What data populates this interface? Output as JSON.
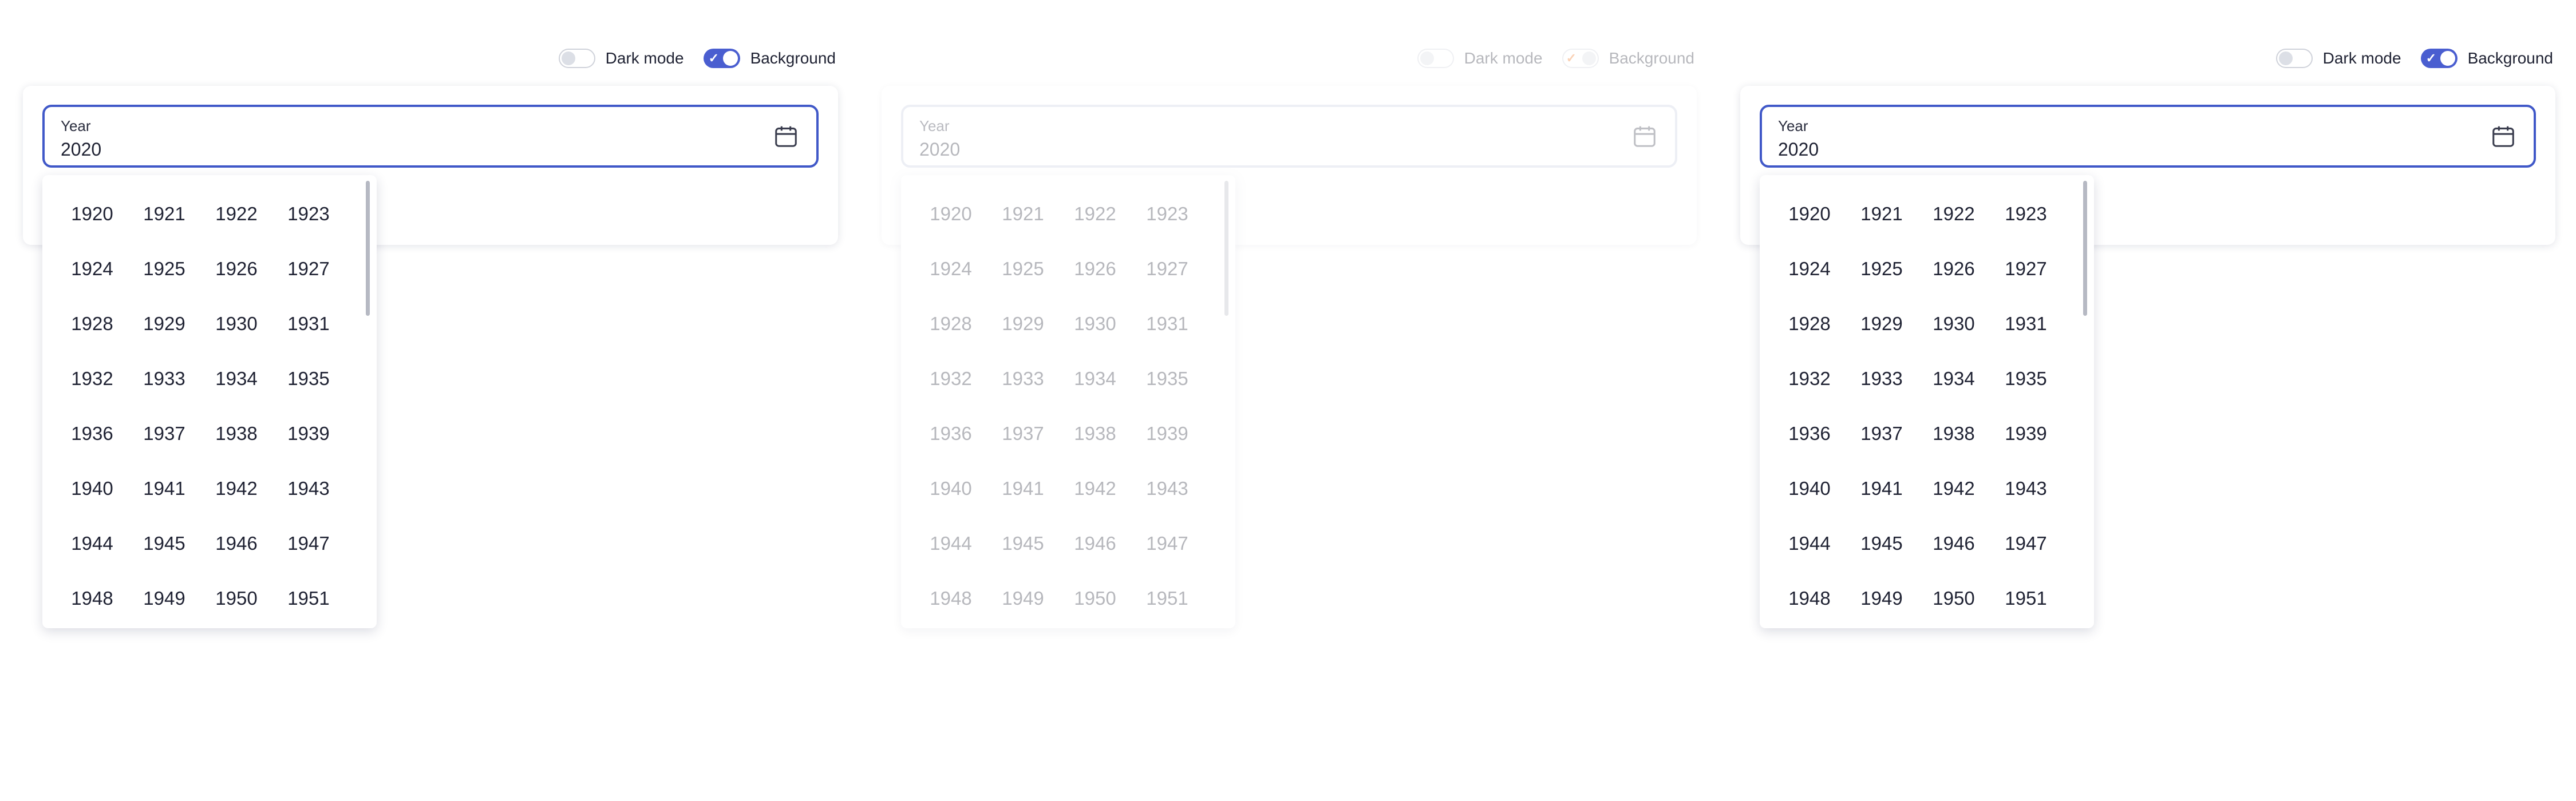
{
  "panels": [
    {
      "id": "left",
      "dark_mode_label": "Dark mode",
      "background_label": "Background",
      "field": {
        "label": "Year",
        "value": "2020"
      },
      "years": [
        "1920",
        "1921",
        "1922",
        "1923",
        "1924",
        "1925",
        "1926",
        "1927",
        "1928",
        "1929",
        "1930",
        "1931",
        "1932",
        "1933",
        "1934",
        "1935",
        "1936",
        "1937",
        "1938",
        "1939",
        "1940",
        "1941",
        "1942",
        "1943",
        "1944",
        "1945",
        "1946",
        "1947",
        "1948",
        "1949",
        "1950",
        "1951"
      ]
    },
    {
      "id": "middle",
      "dark_mode_label": "Dark mode",
      "background_label": "Background",
      "field": {
        "label": "Year",
        "value": "2020"
      },
      "years": [
        "1920",
        "1921",
        "1922",
        "1923",
        "1924",
        "1925",
        "1926",
        "1927",
        "1928",
        "1929",
        "1930",
        "1931",
        "1932",
        "1933",
        "1934",
        "1935",
        "1936",
        "1937",
        "1938",
        "1939",
        "1940",
        "1941",
        "1942",
        "1943",
        "1944",
        "1945",
        "1946",
        "1947",
        "1948",
        "1949",
        "1950",
        "1951"
      ]
    },
    {
      "id": "right",
      "dark_mode_label": "Dark mode",
      "background_label": "Background",
      "field": {
        "label": "Year",
        "value": "2020"
      },
      "years": [
        "1920",
        "1921",
        "1922",
        "1923",
        "1924",
        "1925",
        "1926",
        "1927",
        "1928",
        "1929",
        "1930",
        "1931",
        "1932",
        "1933",
        "1934",
        "1935",
        "1936",
        "1937",
        "1938",
        "1939",
        "1940",
        "1941",
        "1942",
        "1943",
        "1944",
        "1945",
        "1946",
        "1947",
        "1948",
        "1949",
        "1950",
        "1951"
      ]
    }
  ],
  "colors": {
    "accent": "#4058c8",
    "toggle_on": "#4a5ed0",
    "middle_check": "#f0761e",
    "text": "#1f2233"
  },
  "icons": {
    "field_icon": "calendar-icon"
  }
}
